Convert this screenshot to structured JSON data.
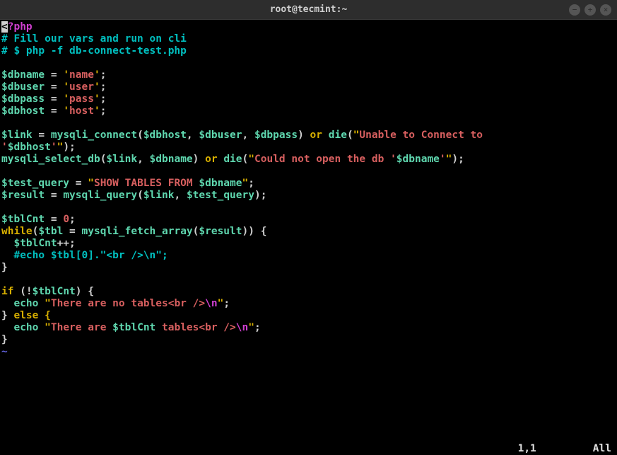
{
  "window": {
    "title": "root@tecmint:~",
    "minimize": "−",
    "maximize": "+",
    "close": "×"
  },
  "code": {
    "phptag_open": "<",
    "phptag_q": "?",
    "phptag_php": "php",
    "comment1": "# Fill our vars and run on cli",
    "comment2": "# $ php -f db-connect-test.php",
    "var_dbname": "$dbname",
    "var_dbuser": "$dbuser",
    "var_dbpass": "$dbpass",
    "var_dbhost": "$dbhost",
    "var_link": "$link",
    "var_testquery": "$test_query",
    "var_result": "$result",
    "var_tblcnt": "$tblCnt",
    "var_tbl": "$tbl",
    "eq": " = ",
    "semi": ";",
    "q": "'",
    "dq": "\"",
    "name": "name",
    "user": "user",
    "pass": "pass",
    "host": "host",
    "mysqli_connect": "mysqli_connect",
    "mysqli_select_db": "mysqli_select_db",
    "mysqli_query": "mysqli_query",
    "mysqli_fetch_array": "mysqli_fetch_array",
    "or": "or",
    "die": "die",
    "lp": "(",
    "rp": ")",
    "comma": ", ",
    "unable": "Unable to Connect to ",
    "couldnot": "Could not open the db ",
    "showtables": "SHOW TABLES FROM ",
    "zero": "0",
    "while": "while",
    "lb": "{",
    "rb": "}",
    "plusplus": "++;",
    "echocomment": "#echo $tbl[0].\"<br />\\n\";",
    "if": "if",
    "bang": " (!",
    "rp_lb": ") {",
    "else": " else {",
    "echo": "echo",
    "sp": " ",
    "noTables": "There are no tables<br />",
    "areTables_a": "There are ",
    "areTables_b": " tables<br />",
    "nl": "\\n",
    "tilde": "~"
  },
  "status": {
    "pos": "1,1",
    "pct": "All"
  }
}
